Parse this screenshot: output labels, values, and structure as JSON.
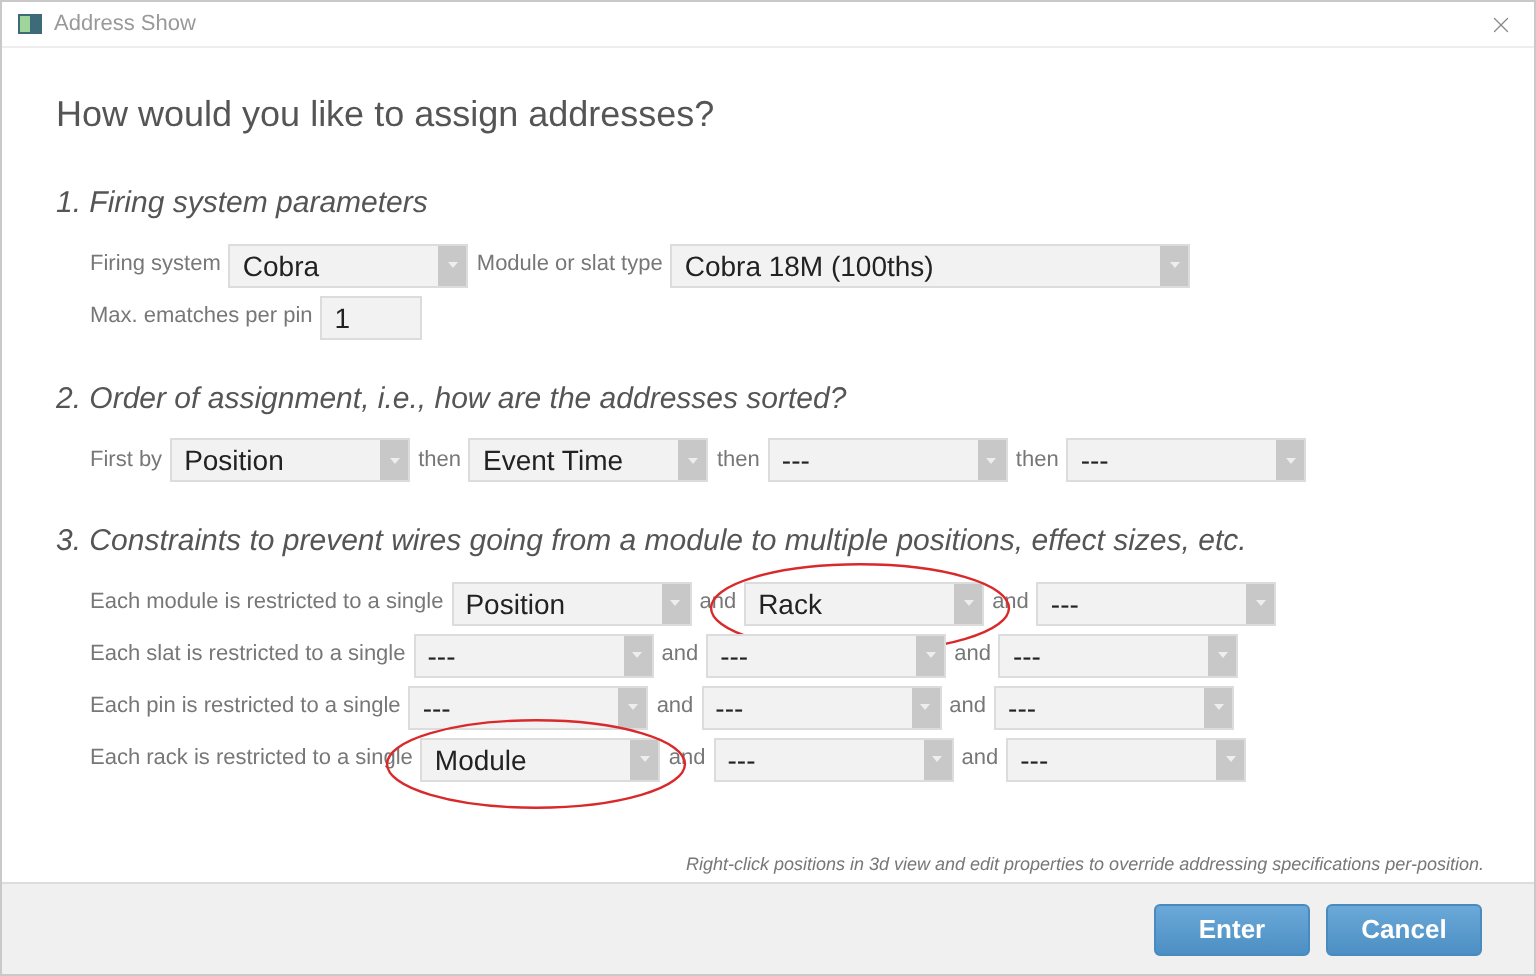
{
  "window": {
    "title": "Address Show"
  },
  "heading": "How would you like to assign addresses?",
  "sections": [
    {
      "title": "1. Firing system parameters",
      "rows": [
        {
          "items": [
            {
              "kind": "label",
              "text": "Firing system"
            },
            {
              "kind": "select",
              "value": "Cobra",
              "circled": false
            },
            {
              "kind": "label",
              "text": "Module or slat type"
            },
            {
              "kind": "select",
              "value": "Cobra 18M (100ths)",
              "circled": false
            }
          ]
        },
        {
          "items": [
            {
              "kind": "label",
              "text": "Max. ematches per pin"
            },
            {
              "kind": "input",
              "value": "1"
            }
          ]
        }
      ]
    },
    {
      "title": "2. Order of assignment, i.e., how are the addresses sorted?",
      "rows": [
        {
          "items": [
            {
              "kind": "label",
              "text": "First by"
            },
            {
              "kind": "select",
              "value": "Position",
              "circled": false
            },
            {
              "kind": "label",
              "text": "then"
            },
            {
              "kind": "select",
              "value": "Event Time",
              "circled": false
            },
            {
              "kind": "label",
              "text": "then"
            },
            {
              "kind": "select",
              "value": "---",
              "circled": false
            },
            {
              "kind": "label",
              "text": "then"
            },
            {
              "kind": "select",
              "value": "---",
              "circled": false
            }
          ]
        }
      ]
    },
    {
      "title": "3. Constraints to prevent wires going from a module to multiple positions, effect sizes, etc.",
      "rows": [
        {
          "items": [
            {
              "kind": "label",
              "text": "Each module is restricted to a single"
            },
            {
              "kind": "select",
              "value": "Position",
              "circled": false
            },
            {
              "kind": "label",
              "text": "and"
            },
            {
              "kind": "select",
              "value": "Rack",
              "circled": true
            },
            {
              "kind": "label",
              "text": "and"
            },
            {
              "kind": "select",
              "value": "---",
              "circled": false
            }
          ]
        },
        {
          "items": [
            {
              "kind": "label",
              "text": "Each slat is restricted to a single"
            },
            {
              "kind": "select",
              "value": "---",
              "circled": false
            },
            {
              "kind": "label",
              "text": "and"
            },
            {
              "kind": "select",
              "value": "---",
              "circled": false
            },
            {
              "kind": "label",
              "text": "and"
            },
            {
              "kind": "select",
              "value": "---",
              "circled": false
            }
          ]
        },
        {
          "items": [
            {
              "kind": "label",
              "text": "Each pin is restricted to a single"
            },
            {
              "kind": "select",
              "value": "---",
              "circled": false
            },
            {
              "kind": "label",
              "text": "and"
            },
            {
              "kind": "select",
              "value": "---",
              "circled": false
            },
            {
              "kind": "label",
              "text": "and"
            },
            {
              "kind": "select",
              "value": "---",
              "circled": false
            }
          ]
        },
        {
          "items": [
            {
              "kind": "label",
              "text": "Each rack is restricted to a single"
            },
            {
              "kind": "select",
              "value": "Module",
              "circled": true
            },
            {
              "kind": "label",
              "text": "and"
            },
            {
              "kind": "select",
              "value": "---",
              "circled": false
            },
            {
              "kind": "label",
              "text": "and"
            },
            {
              "kind": "select",
              "value": "---",
              "circled": false
            }
          ]
        }
      ]
    }
  ],
  "note": "Right-click positions in 3d view and edit properties to override addressing specifications per-position.",
  "buttons": [
    "Enter",
    "Cancel"
  ]
}
